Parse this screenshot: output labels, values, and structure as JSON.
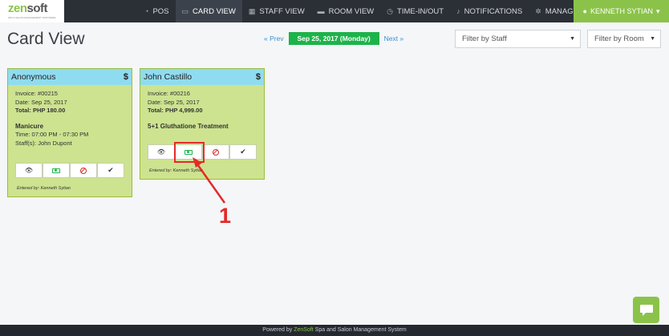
{
  "brand": {
    "name_a": "zen",
    "name_b": "soft",
    "tagline": "SPA & SALON MANAGEMENT SOFTWARE"
  },
  "nav": {
    "items": [
      {
        "label": "POS",
        "icon": "speedometer-icon"
      },
      {
        "label": "CARD VIEW",
        "icon": "card-icon"
      },
      {
        "label": "STAFF VIEW",
        "icon": "calendar-icon"
      },
      {
        "label": "ROOM VIEW",
        "icon": "bed-icon"
      },
      {
        "label": "TIME-IN/OUT",
        "icon": "clock-icon"
      },
      {
        "label": "NOTIFICATIONS",
        "icon": "bell-icon"
      },
      {
        "label": "MANAGE",
        "icon": "gear-icon",
        "caret": "▾"
      }
    ],
    "active": "CARD VIEW",
    "user": {
      "label": "KENNETH SYTIAN",
      "caret": "▾"
    }
  },
  "page": {
    "title": "Card View"
  },
  "date_nav": {
    "prev": "« Prev",
    "date": "Sep 25, 2017 (Monday)",
    "next": "Next »"
  },
  "filters": {
    "staff": {
      "value": "Filter by Staff"
    },
    "room": {
      "value": "Filter by Room"
    }
  },
  "cards": [
    {
      "customer": "Anonymous",
      "currency_icon": "$",
      "invoice": "Invoice: #00215",
      "date": "Date: Sep 25, 2017",
      "total": "Total: PHP 180.00",
      "service": "Manicure",
      "time": "Time: 07:00 PM - 07:30 PM",
      "staff": "Staff(s): John Dupont",
      "entered_by": "Entered by: Kenneth Sytian"
    },
    {
      "customer": "John Castillo",
      "currency_icon": "$",
      "invoice": "Invoice: #00216",
      "date": "Date: Sep 25, 2017",
      "total": "Total: PHP 4,999.00",
      "service": "5+1 Gluthatione Treatment",
      "entered_by": "Entered by: Kenneth Sytian"
    }
  ],
  "annotation": {
    "label": "1",
    "color": "#e32a2a"
  },
  "footer": {
    "prefix": "Powered by ",
    "brand": "ZenSoft",
    "suffix": " Spa and Salon Management System"
  },
  "colors": {
    "accent": "#8bc34a",
    "nav_bg": "#2b2f36",
    "card_bg": "#cde38f",
    "card_head": "#8fdcf0",
    "date_pill": "#1db34a"
  }
}
